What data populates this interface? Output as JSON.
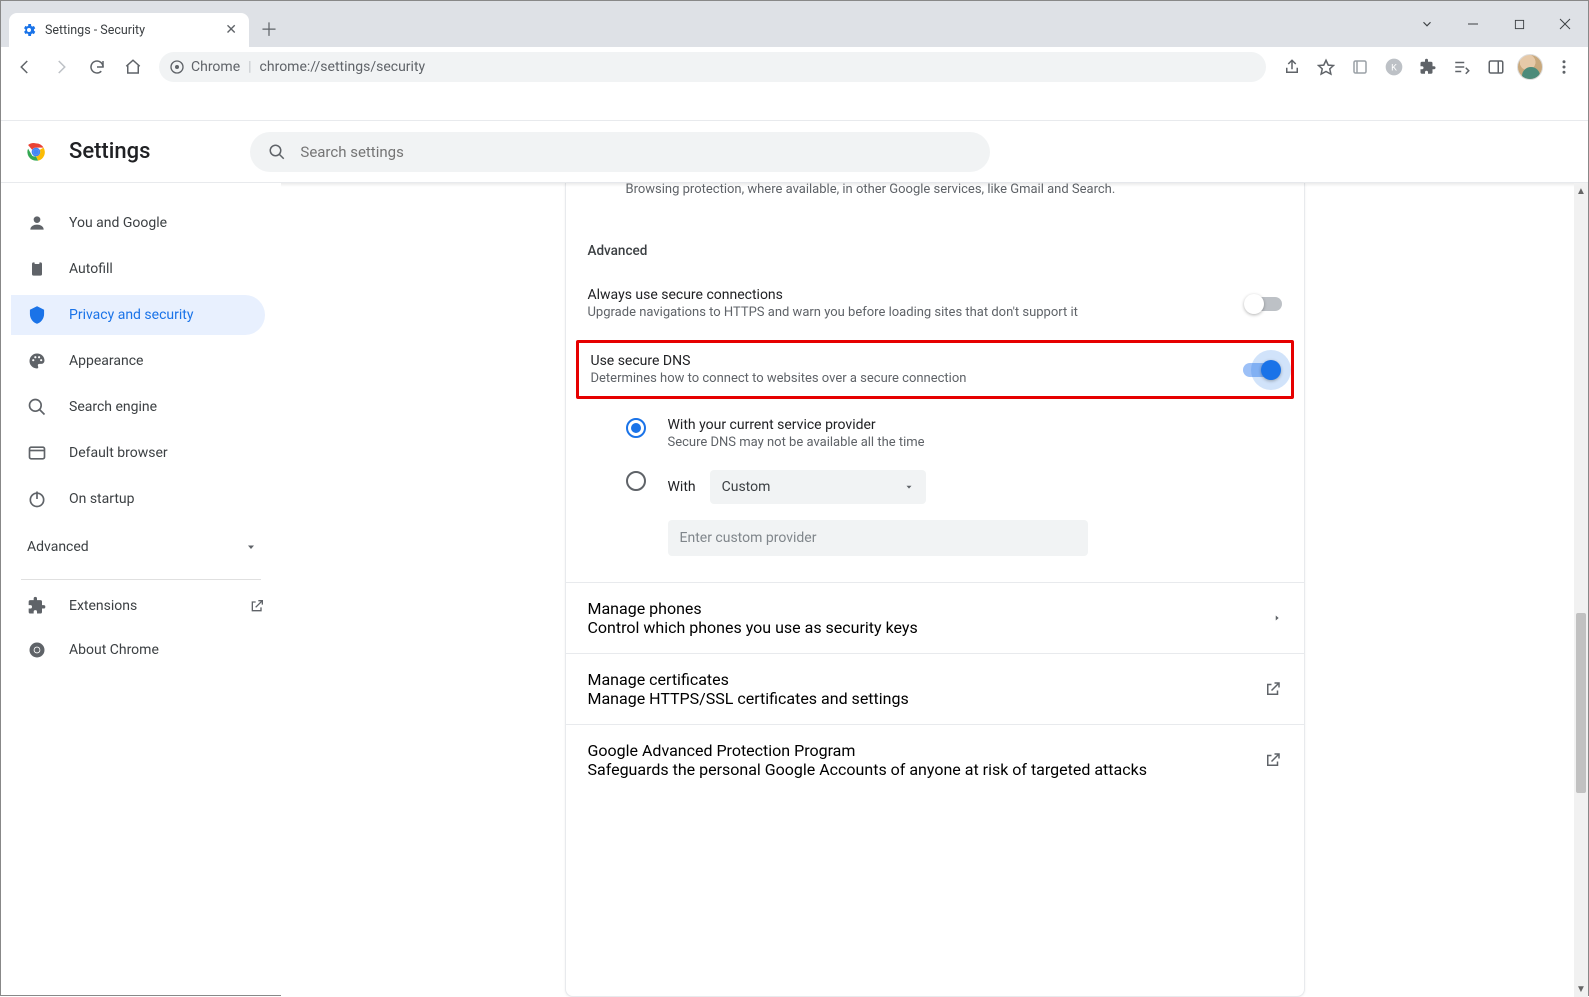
{
  "window": {
    "tab_title": "Settings - Security"
  },
  "omnibox": {
    "site_label": "Chrome",
    "url": "chrome://settings/security"
  },
  "header": {
    "title": "Settings",
    "search_placeholder": "Search settings"
  },
  "sidebar": {
    "items": [
      {
        "label": "You and Google"
      },
      {
        "label": "Autofill"
      },
      {
        "label": "Privacy and security"
      },
      {
        "label": "Appearance"
      },
      {
        "label": "Search engine"
      },
      {
        "label": "Default browser"
      },
      {
        "label": "On startup"
      }
    ],
    "advanced_label": "Advanced",
    "extensions_label": "Extensions",
    "about_label": "About Chrome"
  },
  "content": {
    "truncated_prev": "Browsing protection, where available, in other Google services, like Gmail and Search.",
    "advanced_heading": "Advanced",
    "secure_conn": {
      "label": "Always use secure connections",
      "sub": "Upgrade navigations to HTTPS and warn you before loading sites that don't support it"
    },
    "secure_dns": {
      "label": "Use secure DNS",
      "sub": "Determines how to connect to websites over a secure connection",
      "opt1_label": "With your current service provider",
      "opt1_sub": "Secure DNS may not be available all the time",
      "opt2_label": "With",
      "opt2_select_value": "Custom",
      "opt2_input_placeholder": "Enter custom provider"
    },
    "manage_phones": {
      "label": "Manage phones",
      "sub": "Control which phones you use as security keys"
    },
    "manage_certs": {
      "label": "Manage certificates",
      "sub": "Manage HTTPS/SSL certificates and settings"
    },
    "gapp": {
      "label": "Google Advanced Protection Program",
      "sub": "Safeguards the personal Google Accounts of anyone at risk of targeted attacks"
    }
  }
}
